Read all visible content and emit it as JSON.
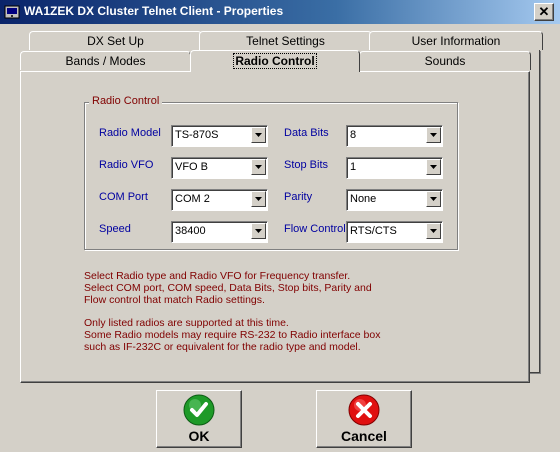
{
  "window": {
    "title": "WA1ZEK DX Cluster Telnet Client - Properties",
    "close_glyph": "✕"
  },
  "tabs_back": [
    "DX Set Up",
    "Telnet Settings",
    "User Information"
  ],
  "tabs_front": [
    "Bands / Modes",
    "Radio Control",
    "Sounds"
  ],
  "active_tab": "Radio Control",
  "group_title": "Radio Control",
  "fields": {
    "radio_model": {
      "label": "Radio Model",
      "value": "TS-870S"
    },
    "radio_vfo": {
      "label": "Radio VFO",
      "value": "VFO B"
    },
    "com_port": {
      "label": "COM Port",
      "value": "COM 2"
    },
    "speed": {
      "label": "Speed",
      "value": "38400"
    },
    "data_bits": {
      "label": "Data Bits",
      "value": "8"
    },
    "stop_bits": {
      "label": "Stop Bits",
      "value": "1"
    },
    "parity": {
      "label": "Parity",
      "value": "None"
    },
    "flow_control": {
      "label": "Flow Control",
      "value": "RTS/CTS"
    }
  },
  "info": {
    "line1": "Select Radio type and Radio VFO for Frequency transfer.",
    "line2": "Select COM port, COM speed, Data Bits, Stop bits, Parity and",
    "line3": "Flow control that match Radio settings.",
    "line4": "Only listed radios are supported at this time.",
    "line5": "Some Radio models may require RS-232 to Radio interface box",
    "line6": "such as IF-232C or equivalent for the radio type and model."
  },
  "buttons": {
    "ok": "OK",
    "cancel": "Cancel"
  },
  "colors": {
    "label_blue": "#0000a0",
    "info_red": "#800000",
    "ok_green": "#1e9a28",
    "cancel_red": "#e01010"
  },
  "icons": {
    "ok": "check-icon",
    "cancel": "x-icon",
    "app": "app-icon"
  }
}
